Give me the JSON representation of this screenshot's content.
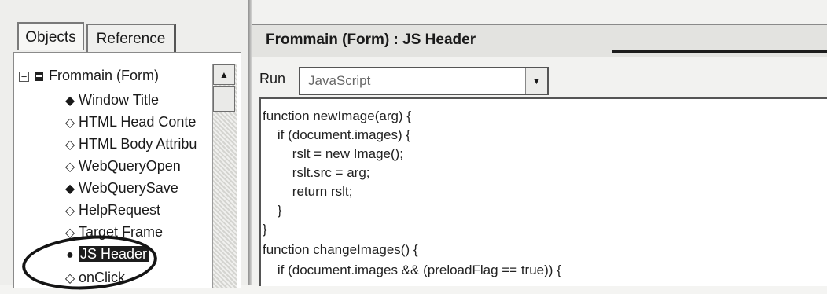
{
  "tabs": [
    {
      "label": "Objects"
    },
    {
      "label": "Reference"
    }
  ],
  "tree": {
    "root": {
      "label": "Frommain (Form)",
      "expander": "−"
    },
    "items": [
      {
        "label": "Window Title",
        "icon": "filled-diamond-icon",
        "glyph": "◆"
      },
      {
        "label": "HTML Head Conte",
        "icon": "outline-diamond-icon",
        "glyph": "◇"
      },
      {
        "label": "HTML Body Attribu",
        "icon": "outline-diamond-icon",
        "glyph": "◇"
      },
      {
        "label": "WebQueryOpen",
        "icon": "outline-diamond-icon",
        "glyph": "◇"
      },
      {
        "label": "WebQuerySave",
        "icon": "filled-diamond-icon",
        "glyph": "◆"
      },
      {
        "label": "HelpRequest",
        "icon": "outline-diamond-icon",
        "glyph": "◇"
      },
      {
        "label": "Target Frame",
        "icon": "outline-diamond-icon",
        "glyph": "◇"
      },
      {
        "label": "JS Header",
        "icon": "filled-circle-icon",
        "glyph": "●",
        "selected": true
      },
      {
        "label": "onClick",
        "icon": "outline-diamond-icon",
        "glyph": "◇"
      }
    ]
  },
  "header": {
    "title": "Frommain (Form) : JS Header"
  },
  "run": {
    "label": "Run",
    "value": "JavaScript",
    "dropdown_glyph": "▼"
  },
  "scrollbar": {
    "up_glyph": "▲"
  },
  "code": {
    "lines": [
      "function newImage(arg) {",
      "    if (document.images) {",
      "        rslt = new Image();",
      "        rslt.src = arg;",
      "        return rslt;",
      "    }",
      "}",
      "function changeImages() {",
      "    if (document.images && (preloadFlag == true)) {"
    ]
  }
}
